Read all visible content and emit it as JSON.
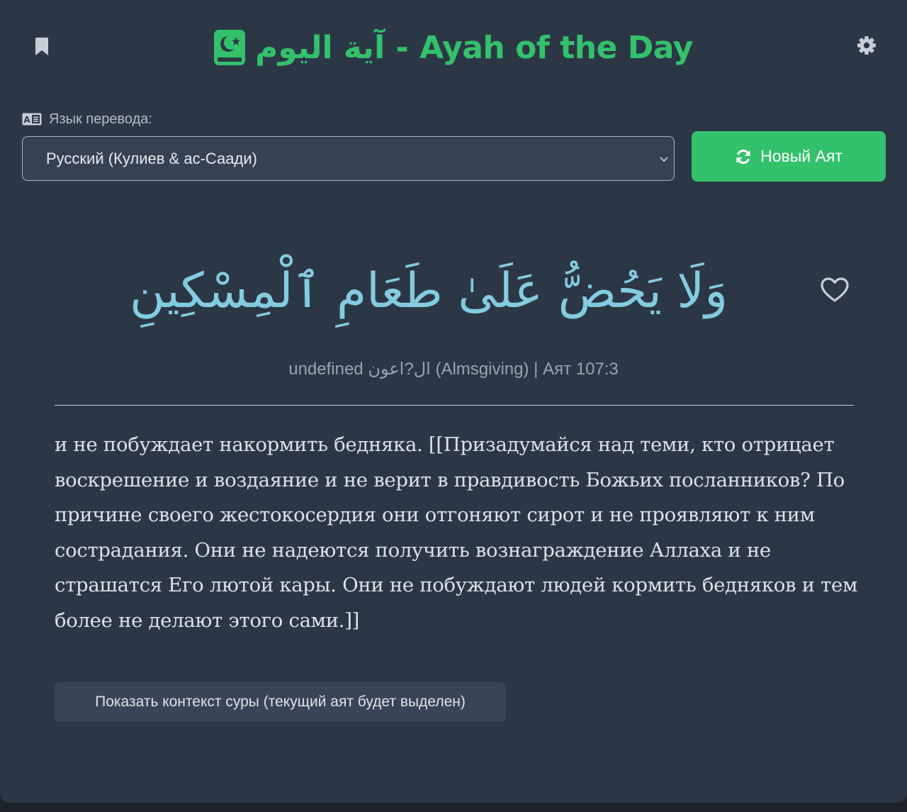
{
  "header": {
    "title_arabic": "آية اليوم",
    "title_separator": " - ",
    "title_english": "Ayah of the Day",
    "logo_icon": "quran-book-icon",
    "bookmark_icon": "bookmark-icon",
    "settings_icon": "gear-icon"
  },
  "controls": {
    "language_label": "Язык перевода:",
    "language_icon": "language-icon",
    "language_selected": "Русский (Кулиев & ас-Саади)",
    "new_ayah_label": "Новый Аят",
    "new_ayah_icon": "refresh-icon"
  },
  "ayah": {
    "arabic": "وَلَا يَحُضُّ عَلَىٰ طَعَامِ ٱلْمِسْكِينِ",
    "reference": "undefined ال?اعون (Almsgiving) | Аят 107:3",
    "favorite_icon": "heart-outline-icon",
    "translation": "и не побуждает накормить бедняка. [[Призадумайся над теми, кто отрицает воскрешение и воздаяние и не верит в правдивость Божьих посланников? По причине своего жестокосердия они отгоняют сирот и не проявляют к ним сострадания. Они не надеются получить вознаграждение Аллаха и не страшатся Его лютой кары. Они не побуждают людей кормить бедняков и тем более не делают этого сами.]]"
  },
  "actions": {
    "show_context_label": "Показать контекст суры (текущий аят будет выделен)"
  },
  "colors": {
    "background": "#2c3746",
    "accent_green": "#33c16b",
    "arabic_text": "#83cce0",
    "input_background": "#364252",
    "muted_text": "#9aa3af"
  }
}
